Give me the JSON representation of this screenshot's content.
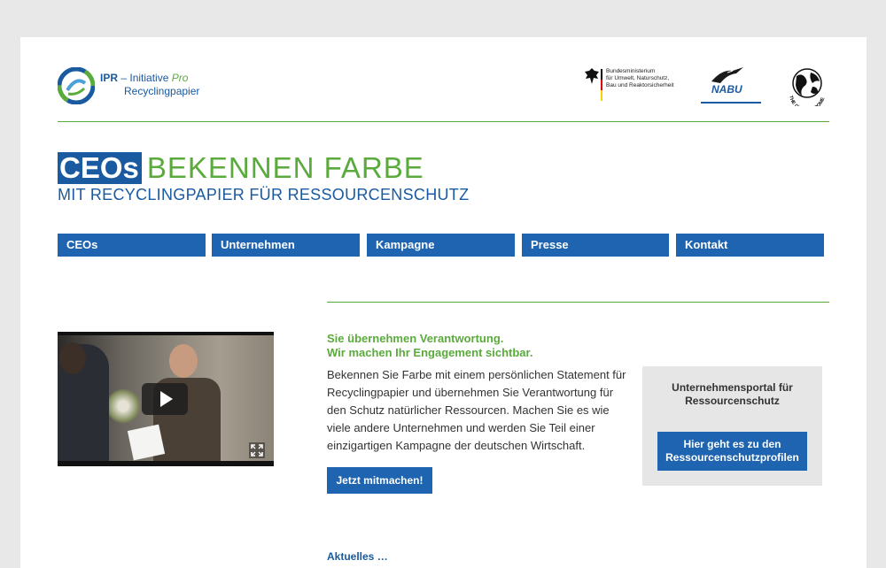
{
  "header": {
    "ipr_logo": {
      "prefix": "IPR",
      "dash": " – Initiative ",
      "pro": "Pro",
      "line2": "Recyclingpapier"
    },
    "bmub_text": "Bundesministerium\nfür Umwelt, Naturschutz,\nBau und Reaktorsicherheit",
    "nabu_text": "NABU",
    "club_text": "THE CLUB OF ROME"
  },
  "title": {
    "ceos": "CEOs",
    "rest": "BEKENNEN FARBE",
    "subtitle": "MIT RECYCLINGPAPIER FÜR RESSOURCENSCHUTZ"
  },
  "nav": {
    "items": [
      {
        "label": "CEOs"
      },
      {
        "label": "Unternehmen"
      },
      {
        "label": "Kampagne"
      },
      {
        "label": "Presse"
      },
      {
        "label": "Kontakt"
      }
    ]
  },
  "main": {
    "headline1": "Sie übernehmen Verantwortung.",
    "headline2": "Wir machen Ihr Engagement sichtbar.",
    "body": "Bekennen Sie Farbe mit einem persönlichen Statement für Recyclingpapier und übernehmen Sie Verantwortung für den Schutz natürlicher Ressourcen. Machen Sie es wie viele andere Unternehmen und werden Sie Teil einer einzigartigen Kampagne der deutschen Wirtschaft.",
    "cta_label": "Jetzt mitmachen!"
  },
  "portal": {
    "heading": "Unternehmensportal für Ressourcenschutz",
    "button_label": "Hier geht es zu den Ressourcenschutzprofilen"
  },
  "bottom_peek": "Aktuelles …",
  "colors": {
    "brand_blue": "#1e64b0",
    "brand_green": "#5aab3b",
    "page_bg": "#e8e8e8"
  }
}
